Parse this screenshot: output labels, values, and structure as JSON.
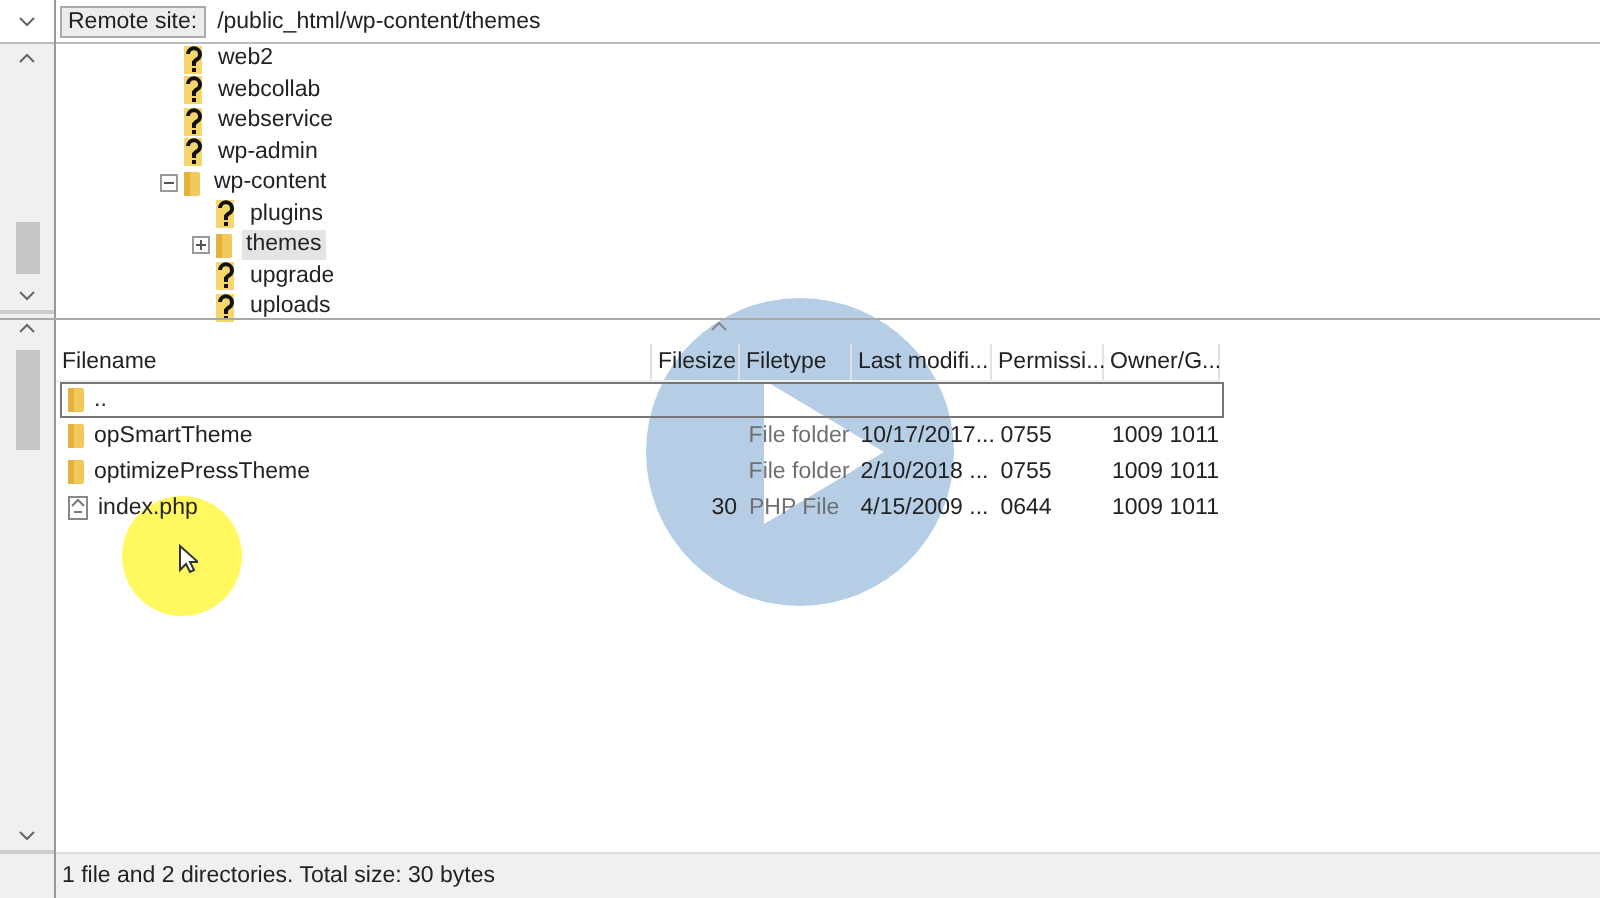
{
  "remote_site": {
    "label": "Remote site:",
    "path": "/public_html/wp-content/themes"
  },
  "tree": [
    {
      "label": "web2",
      "kind": "unknown",
      "selected": false
    },
    {
      "label": "webcollab",
      "kind": "unknown",
      "selected": false
    },
    {
      "label": "webservice",
      "kind": "unknown",
      "selected": false
    },
    {
      "label": "wp-admin",
      "kind": "unknown",
      "selected": false
    },
    {
      "label": "wp-content",
      "kind": "folder",
      "expanded": true,
      "selected": false,
      "children": [
        {
          "label": "plugins",
          "kind": "unknown",
          "selected": false
        },
        {
          "label": "themes",
          "kind": "folder",
          "expanded": false,
          "selected": true
        },
        {
          "label": "upgrade",
          "kind": "unknown",
          "selected": false
        },
        {
          "label": "uploads",
          "kind": "unknown",
          "selected": false
        }
      ]
    }
  ],
  "table": {
    "columns": [
      "Filename",
      "Filesize",
      "Filetype",
      "Last modifi...",
      "Permissi...",
      "Owner/G..."
    ],
    "rows": [
      {
        "kind": "folder",
        "focused": true,
        "cells": [
          "..",
          "",
          "",
          "",
          "",
          ""
        ]
      },
      {
        "kind": "folder",
        "cells": [
          "opSmartTheme",
          "",
          "File folder",
          "10/17/2017...",
          "0755",
          "1009 1011"
        ]
      },
      {
        "kind": "folder",
        "cells": [
          "optimizePressTheme",
          "",
          "File folder",
          "2/10/2018 ...",
          "0755",
          "1009 1011"
        ]
      },
      {
        "kind": "file",
        "cells": [
          "index.php",
          "30",
          "PHP File",
          "4/15/2009 ...",
          "0644",
          "1009 1011"
        ]
      }
    ]
  },
  "status_bar": "1 file and 2 directories. Total size: 30 bytes"
}
